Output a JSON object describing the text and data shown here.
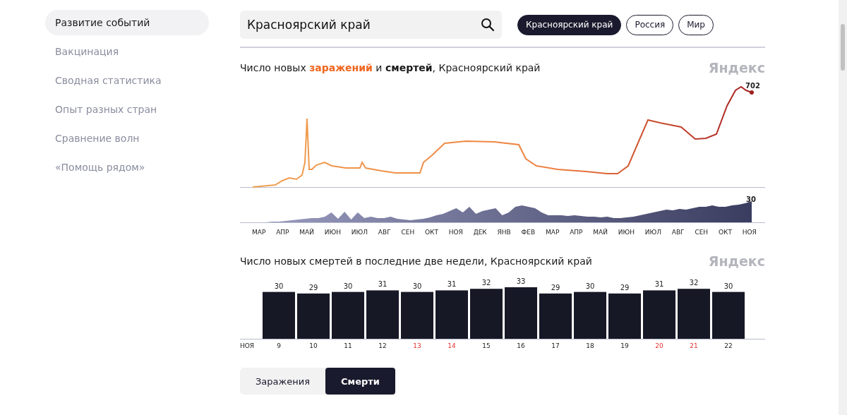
{
  "sidebar": {
    "items": [
      {
        "label": "Развитие событий",
        "selected": true
      },
      {
        "label": "Вакцинация",
        "selected": false
      },
      {
        "label": "Сводная статистика",
        "selected": false
      },
      {
        "label": "Опыт разных стран",
        "selected": false
      },
      {
        "label": "Сравнение волн",
        "selected": false
      },
      {
        "label": "«Помощь рядом»",
        "selected": false
      }
    ]
  },
  "search": {
    "value": "Красноярский край"
  },
  "regions": [
    {
      "label": "Красноярский край",
      "selected": true
    },
    {
      "label": "Россия",
      "selected": false
    },
    {
      "label": "Мир",
      "selected": false
    }
  ],
  "trend_chart": {
    "title": "Число новых **заражений** и **смертей**, Красноярский край",
    "logo": "Яндекс",
    "cases_last": "702",
    "deaths_last": "30",
    "months": [
      "МАР",
      "АПР",
      "МАЙ",
      "ИЮН",
      "ИЮЛ",
      "АВГ",
      "СЕН",
      "ОКТ",
      "НОЯ",
      "ДЕК",
      "ЯНВ",
      "ФЕВ",
      "МАР",
      "АПР",
      "МАЙ",
      "ИЮН",
      "ИЮЛ",
      "АВГ",
      "СЕН",
      "ОКТ",
      "НОЯ"
    ]
  },
  "deaths_chart": {
    "title": "Число новых смертей в последние две недели, Красноярский край",
    "logo": "Яндекс",
    "axis_month": "НОЯ",
    "weekend": [
      false,
      false,
      false,
      false,
      true,
      true,
      false,
      false,
      false,
      false,
      false,
      true,
      true,
      false
    ],
    "chart_data": {
      "type": "bar",
      "categories": [
        "9",
        "10",
        "11",
        "12",
        "13",
        "14",
        "15",
        "16",
        "17",
        "18",
        "19",
        "20",
        "21",
        "22"
      ],
      "values": [
        30,
        29,
        30,
        31,
        30,
        31,
        32,
        33,
        29,
        30,
        29,
        31,
        32,
        30
      ],
      "data_labels": true
    }
  },
  "mode_toggle": [
    {
      "label": "Заражения",
      "selected": false
    },
    {
      "label": "Смерти",
      "selected": true
    }
  ]
}
